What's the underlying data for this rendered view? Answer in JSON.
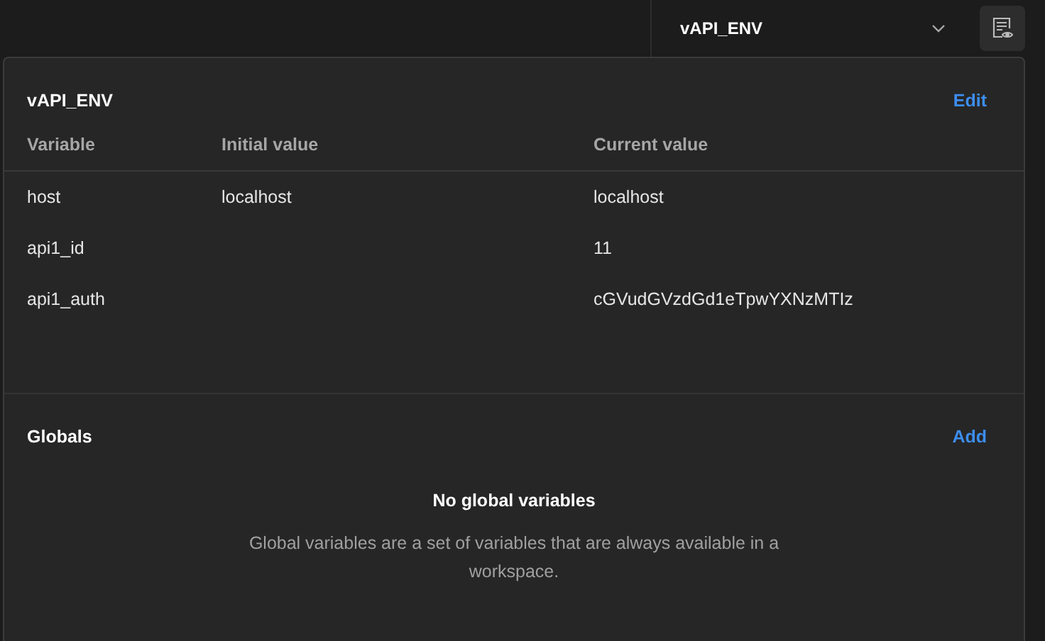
{
  "environment_selector": {
    "value": "vAPI_ENV"
  },
  "environment": {
    "title": "vAPI_ENV",
    "action": "Edit",
    "columns": [
      "Variable",
      "Initial value",
      "Current value"
    ],
    "rows": [
      {
        "variable": "host",
        "initial": "localhost",
        "current": "localhost"
      },
      {
        "variable": "api1_id",
        "initial": "",
        "current": "11"
      },
      {
        "variable": "api1_auth",
        "initial": "",
        "current": "cGVudGVzdGd1eTpwYXNzMTIz"
      }
    ]
  },
  "globals": {
    "title": "Globals",
    "action": "Add",
    "empty_title": "No global variables",
    "empty_text": "Global variables are a set of variables that are always available in a workspace."
  }
}
